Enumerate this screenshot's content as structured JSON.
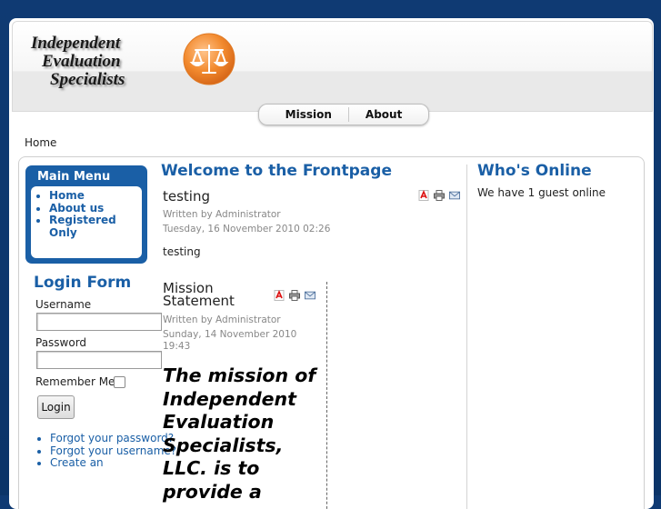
{
  "header": {
    "logo_line1": "Independent",
    "logo_line2": "Evaluation",
    "logo_line3": "Specialists",
    "logo_icon": "scales-of-justice-icon"
  },
  "nav": {
    "items": [
      "Mission",
      "About"
    ]
  },
  "breadcrumb": "Home",
  "main_menu": {
    "title": "Main Menu",
    "items": [
      "Home",
      "About us",
      "Registered Only"
    ]
  },
  "login": {
    "title": "Login Form",
    "username_label": "Username",
    "username_value": "",
    "password_label": "Password",
    "password_value": "",
    "remember_label": "Remember Me",
    "button_label": "Login",
    "links": [
      "Forgot your password?",
      "Forgot your username?",
      "Create an"
    ]
  },
  "frontpage": {
    "title": "Welcome to the Frontpage",
    "article1": {
      "title": "testing",
      "author": "Written by Administrator",
      "date": "Tuesday, 16 November 2010 02:26",
      "body": "testing"
    },
    "article2": {
      "title_line1": "Mission",
      "title_line2": "Statement",
      "author": "Written by Administrator",
      "date_line1": "Sunday, 14 November 2010",
      "date_line2": "19:43",
      "body": "The mission of Independent Evaluation Specialists, LLC. is to provide a"
    },
    "article_icons": [
      "pdf-icon",
      "print-icon",
      "email-icon"
    ]
  },
  "whos_online": {
    "title": "Who's Online",
    "text": "We have 1 guest online"
  },
  "colors": {
    "background": "#0f3a73",
    "accent": "#1a5fa6",
    "logo_orange": "#f28a2e"
  }
}
